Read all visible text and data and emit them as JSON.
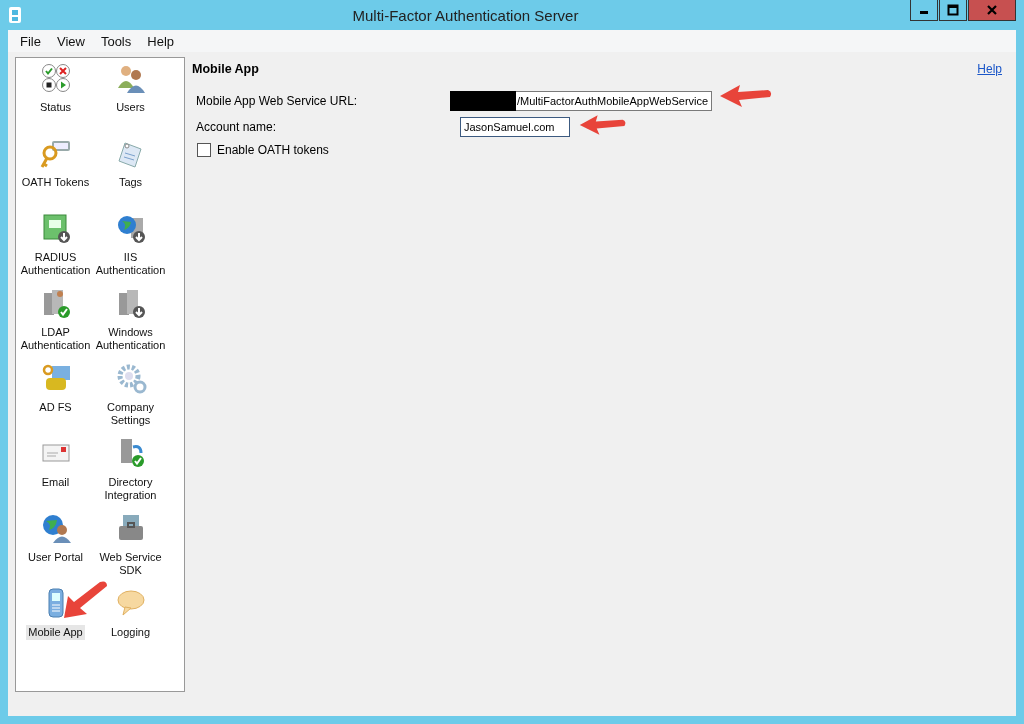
{
  "window": {
    "title": "Multi-Factor Authentication Server"
  },
  "menu": [
    "File",
    "View",
    "Tools",
    "Help"
  ],
  "sidebar": {
    "items": [
      {
        "label": "Status",
        "selected": false
      },
      {
        "label": "Users",
        "selected": false
      },
      {
        "label": "OATH Tokens",
        "selected": false
      },
      {
        "label": "Tags",
        "selected": false
      },
      {
        "label": "RADIUS Authentication",
        "selected": false
      },
      {
        "label": "IIS Authentication",
        "selected": false
      },
      {
        "label": "LDAP Authentication",
        "selected": false
      },
      {
        "label": "Windows Authentication",
        "selected": false
      },
      {
        "label": "AD FS",
        "selected": false
      },
      {
        "label": "Company Settings",
        "selected": false
      },
      {
        "label": "Email",
        "selected": false
      },
      {
        "label": "Directory Integration",
        "selected": false
      },
      {
        "label": "User Portal",
        "selected": false
      },
      {
        "label": "Web Service SDK",
        "selected": false
      },
      {
        "label": "Mobile App",
        "selected": true
      },
      {
        "label": "Logging",
        "selected": false
      }
    ]
  },
  "panel": {
    "title": "Mobile App",
    "help": "Help",
    "fields": [
      {
        "label": "Mobile App Web Service URL:",
        "value": "/MultiFactorAuthMobileAppWebService",
        "redacted": true
      },
      {
        "label": "Account name:",
        "value": "JasonSamuel.com"
      }
    ],
    "checkbox": {
      "label": "Enable OATH tokens",
      "checked": false
    }
  }
}
